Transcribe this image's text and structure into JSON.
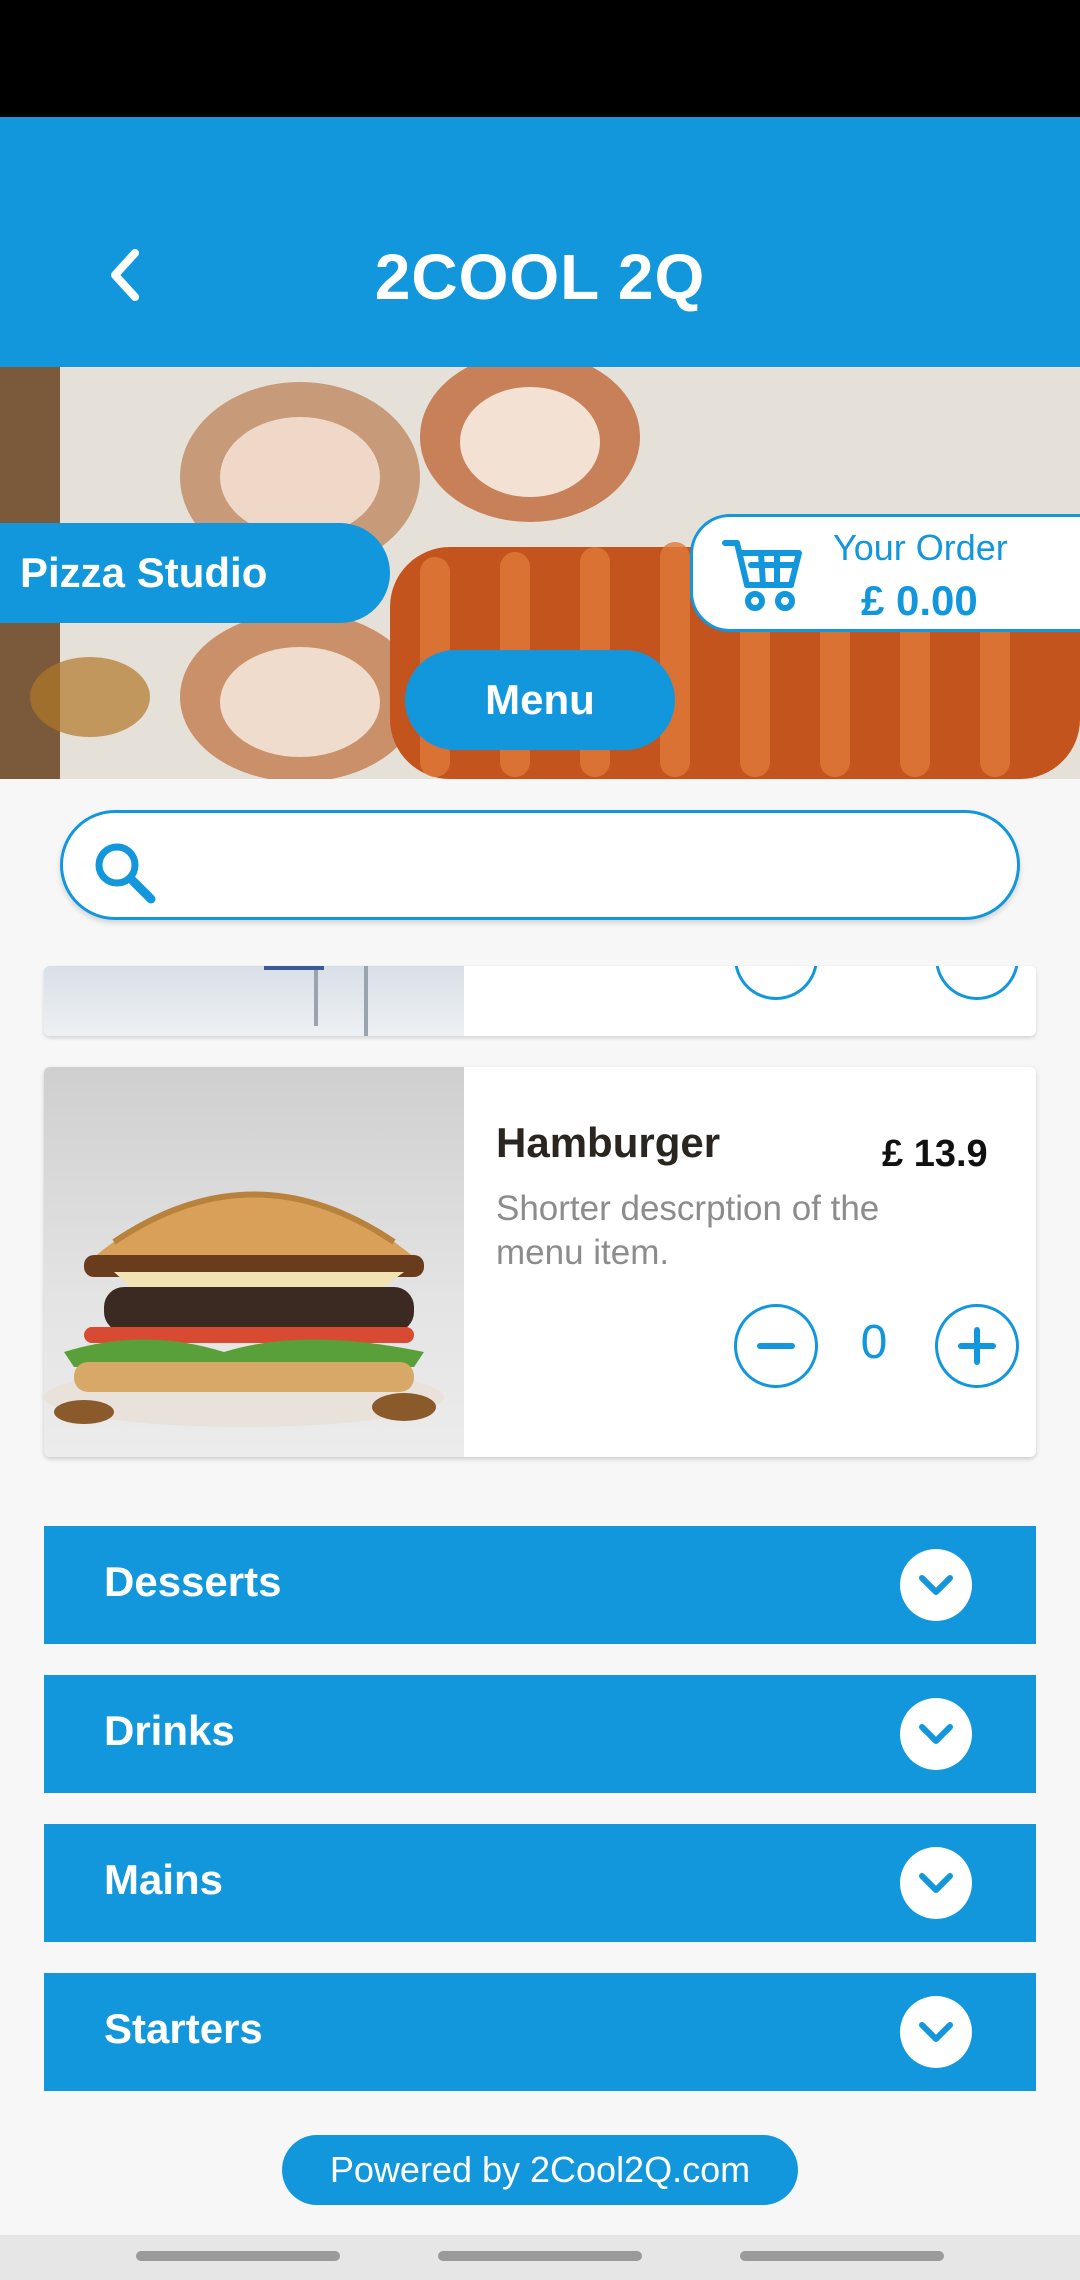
{
  "colors": {
    "accent": "#1297DD",
    "text_dark": "#2b2520",
    "muted": "#8c8c8c"
  },
  "header": {
    "title": "2COOL 2Q",
    "back_icon": "chevron-left-icon"
  },
  "hero": {
    "store_name": "Pizza Studio",
    "order": {
      "label": "Your Order",
      "total": "£ 0.00",
      "icon": "cart-icon"
    },
    "menu_button": "Menu"
  },
  "search": {
    "placeholder": "",
    "value": "",
    "icon": "search-icon"
  },
  "items": [
    {
      "name": "Hamburger",
      "price": "£ 13.9",
      "description": " Shorter descrption of the menu item.",
      "quantity": "0"
    }
  ],
  "categories": [
    {
      "label": "Desserts"
    },
    {
      "label": "Drinks"
    },
    {
      "label": "Mains"
    },
    {
      "label": "Starters"
    }
  ],
  "footer": {
    "powered_by": "Powered by 2Cool2Q.com"
  }
}
